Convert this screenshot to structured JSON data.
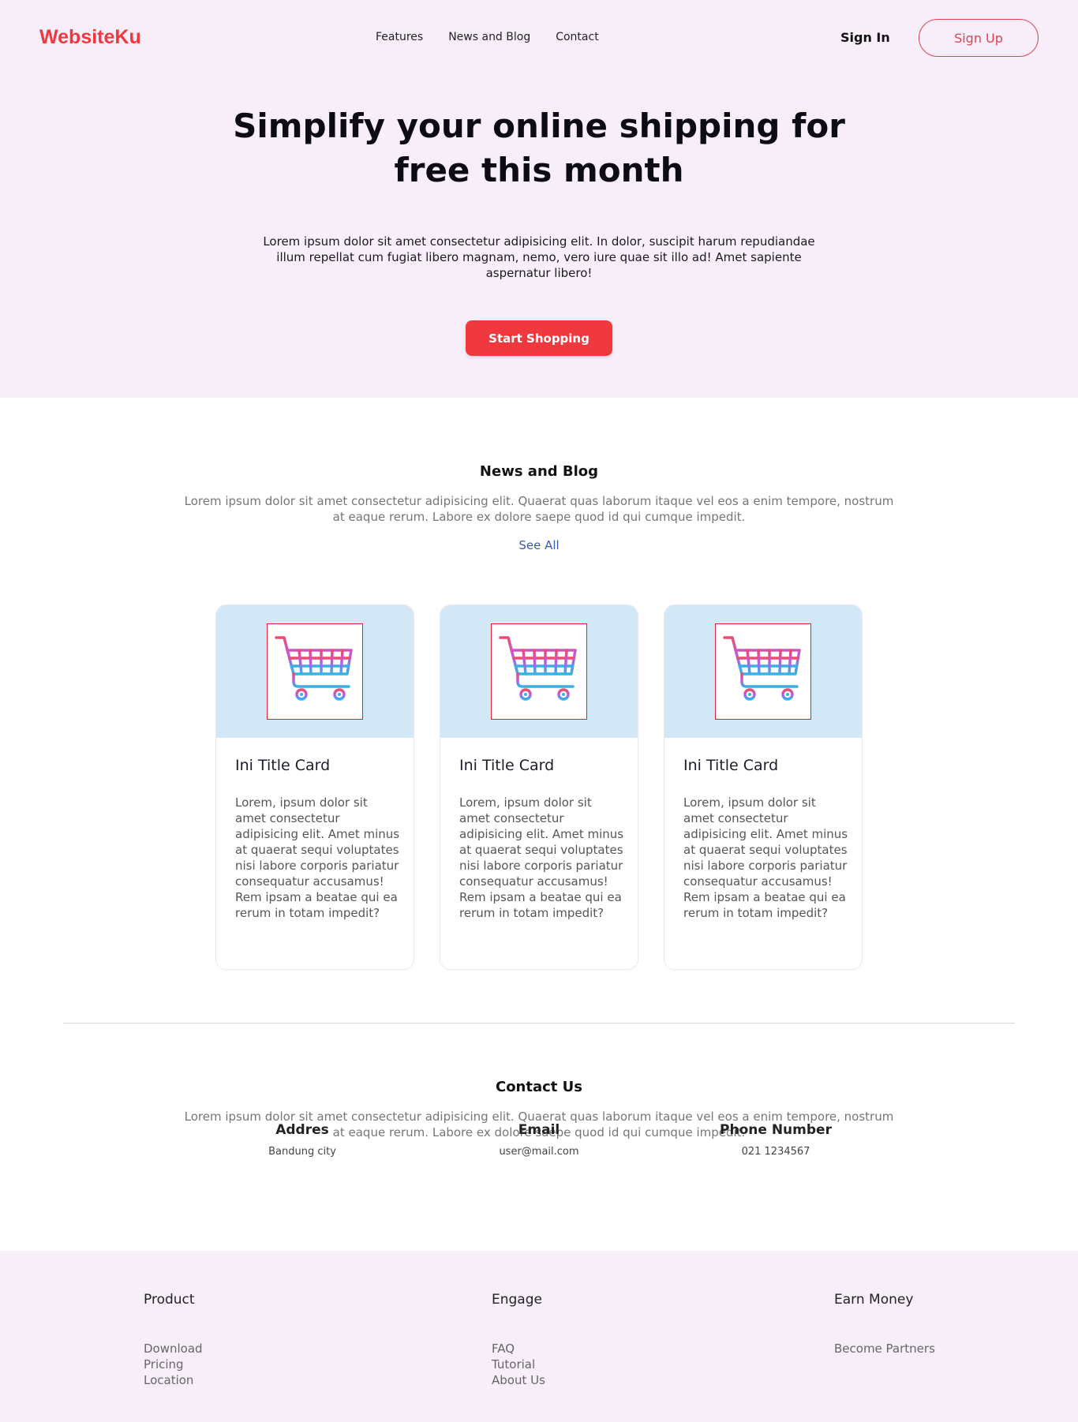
{
  "nav": {
    "brand": "WebsiteKu",
    "links": [
      "Features",
      "News and Blog",
      "Contact"
    ],
    "sign_in": "Sign In",
    "sign_up": "Sign Up"
  },
  "hero": {
    "title": "Simplify your online shipping for free this month",
    "description": "Lorem ipsum dolor sit amet consectetur adipisicing elit. In dolor, suscipit harum repudiandae illum repellat cum fugiat libero magnam, nemo, vero iure quae sit illo ad! Amet sapiente aspernatur libero!",
    "button": "Start Shopping"
  },
  "news": {
    "title": "News and Blog",
    "description": "Lorem ipsum dolor sit amet consectetur adipisicing elit. Quaerat quas laborum itaque vel eos a enim tempore, nostrum at eaque rerum. Labore ex dolore saepe quod id qui cumque impedit.",
    "see_all": "See All",
    "cards": [
      {
        "icon": "shopping-cart-icon",
        "title": "Ini Title Card",
        "text": "Lorem, ipsum dolor sit amet consectetur adipisicing elit. Amet minus at quaerat sequi voluptates nisi labore corporis pariatur consequatur accusamus! Rem ipsam a beatae qui ea rerum in totam impedit?"
      },
      {
        "icon": "shopping-cart-icon",
        "title": "Ini Title Card",
        "text": "Lorem, ipsum dolor sit amet consectetur adipisicing elit. Amet minus at quaerat sequi voluptates nisi labore corporis pariatur consequatur accusamus! Rem ipsam a beatae qui ea rerum in totam impedit?"
      },
      {
        "icon": "shopping-cart-icon",
        "title": "Ini Title Card",
        "text": "Lorem, ipsum dolor sit amet consectetur adipisicing elit. Amet minus at quaerat sequi voluptates nisi labore corporis pariatur consequatur accusamus! Rem ipsam a beatae qui ea rerum in totam impedit?"
      }
    ]
  },
  "contact": {
    "title": "Contact Us",
    "description": "Lorem ipsum dolor sit amet consectetur adipisicing elit. Quaerat quas laborum itaque vel eos a enim tempore, nostrum at eaque rerum. Labore ex dolore saepe quod id qui cumque impedit.",
    "items": [
      {
        "label": "Addres",
        "value": "Bandung city"
      },
      {
        "label": "Email",
        "value": "user@mail.com"
      },
      {
        "label": "Phone Number",
        "value": "021 1234567"
      }
    ]
  },
  "footer": {
    "columns": [
      {
        "heading": "Product",
        "links": [
          "Download",
          "Pricing",
          "Location"
        ]
      },
      {
        "heading": "Engage",
        "links": [
          "FAQ",
          "Tutorial",
          "About Us"
        ]
      },
      {
        "heading": "Earn Money",
        "links": [
          "Become Partners"
        ]
      }
    ]
  },
  "colors": {
    "brand": "#f0393f",
    "hero_bg": "#f7eefa",
    "card_top_bg": "#d3e8f6",
    "link": "#3b5aa6"
  }
}
